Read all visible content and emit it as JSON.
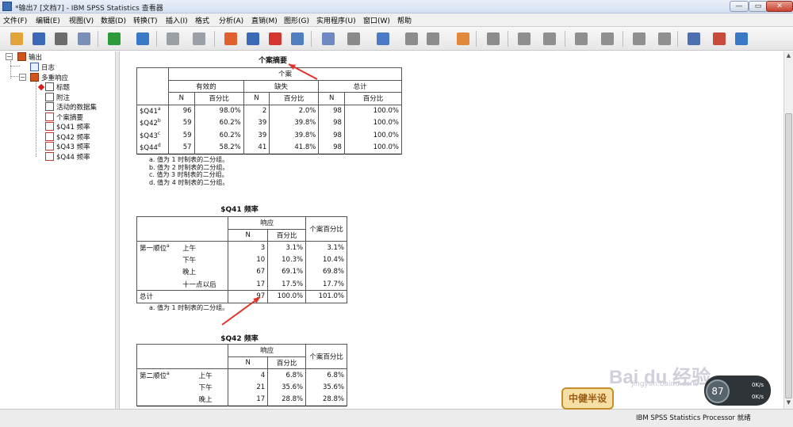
{
  "window": {
    "title": "*输出7 [文档7] - IBM SPSS Statistics 查看器"
  },
  "menu": [
    "文件(F)",
    "编辑(E)",
    "视图(V)",
    "数据(D)",
    "转换(T)",
    "插入(I)",
    "格式",
    "分析(A)",
    "直销(M)",
    "图形(G)",
    "实用程序(U)",
    "窗口(W)",
    "帮助"
  ],
  "toolbar": {
    "buttons": [
      {
        "name": "open-icon",
        "color": "#e2a43a"
      },
      {
        "name": "save-icon",
        "color": "#3a6ab5"
      },
      {
        "name": "print-icon",
        "color": "#6c6c6c"
      },
      {
        "name": "print-preview-icon",
        "color": "#7a8fb5"
      },
      {
        "name": "export-icon",
        "color": "#2f9a3a"
      },
      {
        "name": "recall-dialog-icon",
        "color": "#3a78c8"
      },
      {
        "name": "undo-icon",
        "color": "#9aa0a6"
      },
      {
        "name": "redo-icon",
        "color": "#9aa0a6"
      },
      {
        "name": "goto-data-icon",
        "color": "#e0602e"
      },
      {
        "name": "goto-case-icon",
        "color": "#3a6ab5"
      },
      {
        "name": "goto-variable-icon",
        "color": "#d5352f"
      },
      {
        "name": "variables-icon",
        "color": "#4f7fbf"
      },
      {
        "name": "select-cases-icon",
        "color": "#6e88c2"
      },
      {
        "name": "weight-cases-icon",
        "color": "#8a8a8a"
      },
      {
        "name": "value-labels-icon",
        "color": "#4b7bc7"
      },
      {
        "name": "use-variable-sets-icon",
        "color": "#8c8c8c"
      },
      {
        "name": "show-all-variables-icon",
        "color": "#8c8c8c"
      },
      {
        "name": "spelling-icon",
        "color": "#e2883a"
      },
      {
        "name": "designate-window-icon",
        "color": "#8c8c8c"
      },
      {
        "name": "back-icon",
        "color": "#8f8f8f"
      },
      {
        "name": "forward-icon",
        "color": "#8f8f8f"
      },
      {
        "name": "expand-icon",
        "color": "#8f8f8f"
      },
      {
        "name": "collapse-icon",
        "color": "#8f8f8f"
      },
      {
        "name": "show-icon",
        "color": "#8f8f8f"
      },
      {
        "name": "hide-icon",
        "color": "#8f8f8f"
      },
      {
        "name": "insert-heading-icon",
        "color": "#4b6fb0"
      },
      {
        "name": "insert-title-icon",
        "color": "#c84a3a"
      },
      {
        "name": "insert-text-icon",
        "color": "#3a78c8"
      }
    ]
  },
  "navigator": {
    "root": "输出",
    "log": "日志",
    "group": "多重响应",
    "children": [
      "标题",
      "附注",
      "活动的数据集",
      "个案摘要",
      "$Q41 频率",
      "$Q42 频率",
      "$Q43 频率",
      "$Q44 频率"
    ]
  },
  "case_summary": {
    "title": "个案摘要",
    "header_cases": "个案",
    "header_valid": "有效的",
    "header_missing": "缺失",
    "header_total": "总计",
    "col_n": "N",
    "col_pct": "百分比",
    "rows": [
      {
        "label": "$Q41",
        "sup": "a",
        "vn": "96",
        "vp": "98.0%",
        "mn": "2",
        "mp": "2.0%",
        "tn": "98",
        "tp": "100.0%"
      },
      {
        "label": "$Q42",
        "sup": "b",
        "vn": "59",
        "vp": "60.2%",
        "mn": "39",
        "mp": "39.8%",
        "tn": "98",
        "tp": "100.0%"
      },
      {
        "label": "$Q43",
        "sup": "c",
        "vn": "59",
        "vp": "60.2%",
        "mn": "39",
        "mp": "39.8%",
        "tn": "98",
        "tp": "100.0%"
      },
      {
        "label": "$Q44",
        "sup": "d",
        "vn": "57",
        "vp": "58.2%",
        "mn": "41",
        "mp": "41.8%",
        "tn": "98",
        "tp": "100.0%"
      }
    ],
    "footnotes": [
      "a. 值为 1 时制表的二分组。",
      "b. 值为 2 时制表的二分组。",
      "c. 值为 3 时制表的二分组。",
      "d. 值为 4 时制表的二分组。"
    ]
  },
  "q41": {
    "title": "$Q41 频率",
    "header_response": "响应",
    "col_n": "N",
    "col_pct": "百分比",
    "col_case_pct": "个案百分比",
    "group_label": "第一顺位",
    "group_sup": "a",
    "rows": [
      {
        "label": "上午",
        "n": "3",
        "pct": "3.1%",
        "cpct": "3.1%"
      },
      {
        "label": "下午",
        "n": "10",
        "pct": "10.3%",
        "cpct": "10.4%"
      },
      {
        "label": "晚上",
        "n": "67",
        "pct": "69.1%",
        "cpct": "69.8%"
      },
      {
        "label": "十一点以后",
        "n": "17",
        "pct": "17.5%",
        "cpct": "17.7%"
      }
    ],
    "total_label": "总计",
    "total": {
      "n": "97",
      "pct": "100.0%",
      "cpct": "101.0%"
    },
    "footnote": "a. 值为 1 时制表的二分组。"
  },
  "q42": {
    "title": "$Q42 频率",
    "header_response": "响应",
    "col_n": "N",
    "col_pct": "百分比",
    "col_case_pct": "个案百分比",
    "group_label": "第二顺位",
    "group_sup": "a",
    "rows": [
      {
        "label": "上午",
        "n": "4",
        "pct": "6.8%",
        "cpct": "6.8%"
      },
      {
        "label": "下午",
        "n": "21",
        "pct": "35.6%",
        "cpct": "35.6%"
      },
      {
        "label": "晚上",
        "n": "17",
        "pct": "28.8%",
        "cpct": "28.8%"
      }
    ]
  },
  "status": {
    "text": "IBM SPSS Statistics Processor 就绪"
  },
  "watermark": {
    "badge": "中健半设",
    "logo": "Bai du 经验",
    "url": "jingyan.baidu.com"
  },
  "speed": {
    "value": "87",
    "unit": "%",
    "up": "0K/s",
    "down": "0K/s"
  },
  "annotation_color": "#e0322b"
}
